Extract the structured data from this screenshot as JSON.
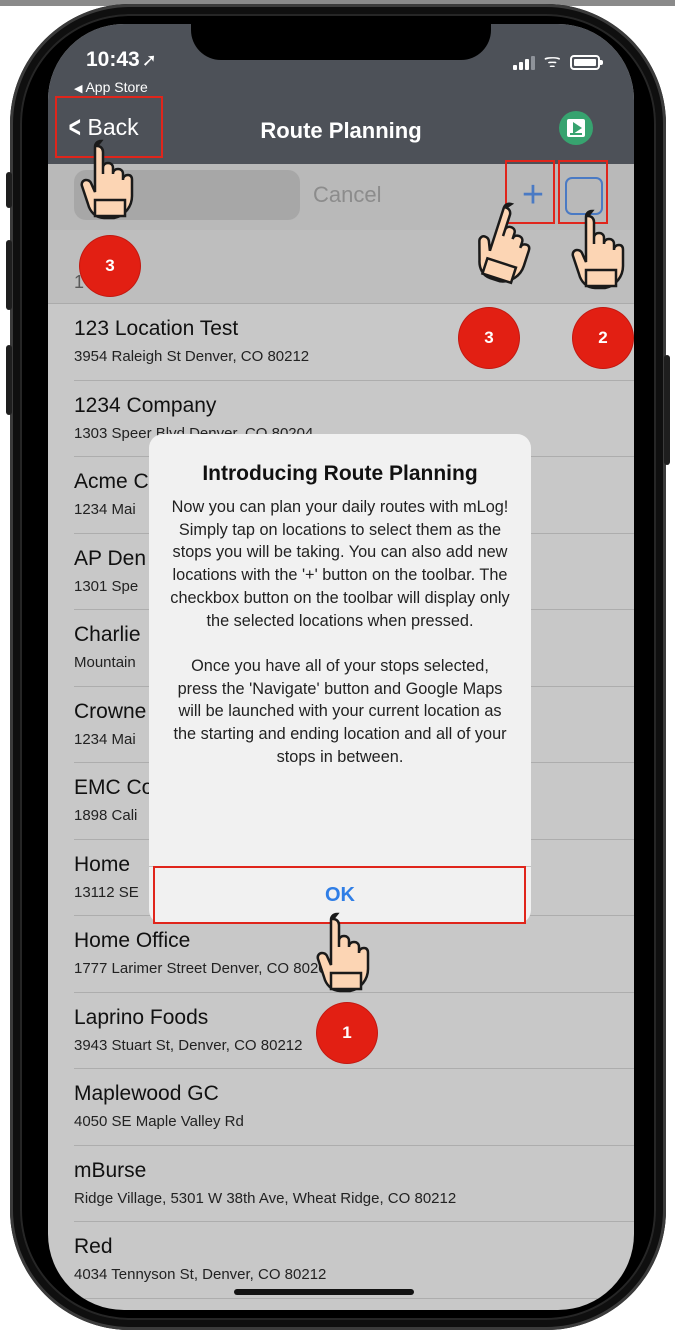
{
  "status_bar": {
    "time": "10:43",
    "back_to_app": "App Store"
  },
  "nav": {
    "back_label": "Back",
    "title": "Route Planning"
  },
  "search": {
    "placeholder": "",
    "cancel_label": "Cancel",
    "add_icon": "plus-icon",
    "filter_icon": "checkbox-icon"
  },
  "section": {
    "letter": "1"
  },
  "locations": [
    {
      "name": "123 Location Test",
      "address": "3954 Raleigh St Denver, CO 80212"
    },
    {
      "name": "1234 Company",
      "address": "1303 Speer Blvd Denver, CO 80204"
    },
    {
      "name": "Acme C",
      "address": "1234 Mai"
    },
    {
      "name": "AP Den",
      "address": "1301 Spe"
    },
    {
      "name": "Charlie",
      "address": "Mountain"
    },
    {
      "name": "Crowne",
      "address": "1234 Mai"
    },
    {
      "name": "EMC Co",
      "address": "1898 Cali"
    },
    {
      "name": "Home",
      "address": "13112 SE"
    },
    {
      "name": "Home Office",
      "address": "1777 Larimer Street Denver, CO 80202"
    },
    {
      "name": "Laprino Foods",
      "address": "3943 Stuart St, Denver, CO  80212"
    },
    {
      "name": "Maplewood GC",
      "address": "4050 SE Maple Valley Rd"
    },
    {
      "name": "mBurse",
      "address": "Ridge Village, 5301 W 38th Ave, Wheat Ridge, CO  80212"
    },
    {
      "name": "Red",
      "address": "4034 Tennyson St, Denver, CO  80212"
    }
  ],
  "dialog": {
    "title": "Introducing Route Planning",
    "body": "Now you can plan your daily routes with mLog! Simply tap on locations to select them as the stops you will be taking. You can also add new locations with the '+' button on the toolbar. The checkbox button on the toolbar will display only the selected locations when pressed.\n\nOnce you have all of your stops selected, press the 'Navigate' button and Google Maps will be launched with your current location as the starting and ending location and all of your stops in between.",
    "ok_label": "OK"
  },
  "annotations": {
    "back_step": "3",
    "add_step": "3",
    "checkbox_step": "2",
    "ok_step": "1"
  },
  "colors": {
    "nav_bar": "#4d5158",
    "accent_blue": "#2f7ee6",
    "video_button": "#37a36f",
    "annotation_red": "#e21f13"
  }
}
